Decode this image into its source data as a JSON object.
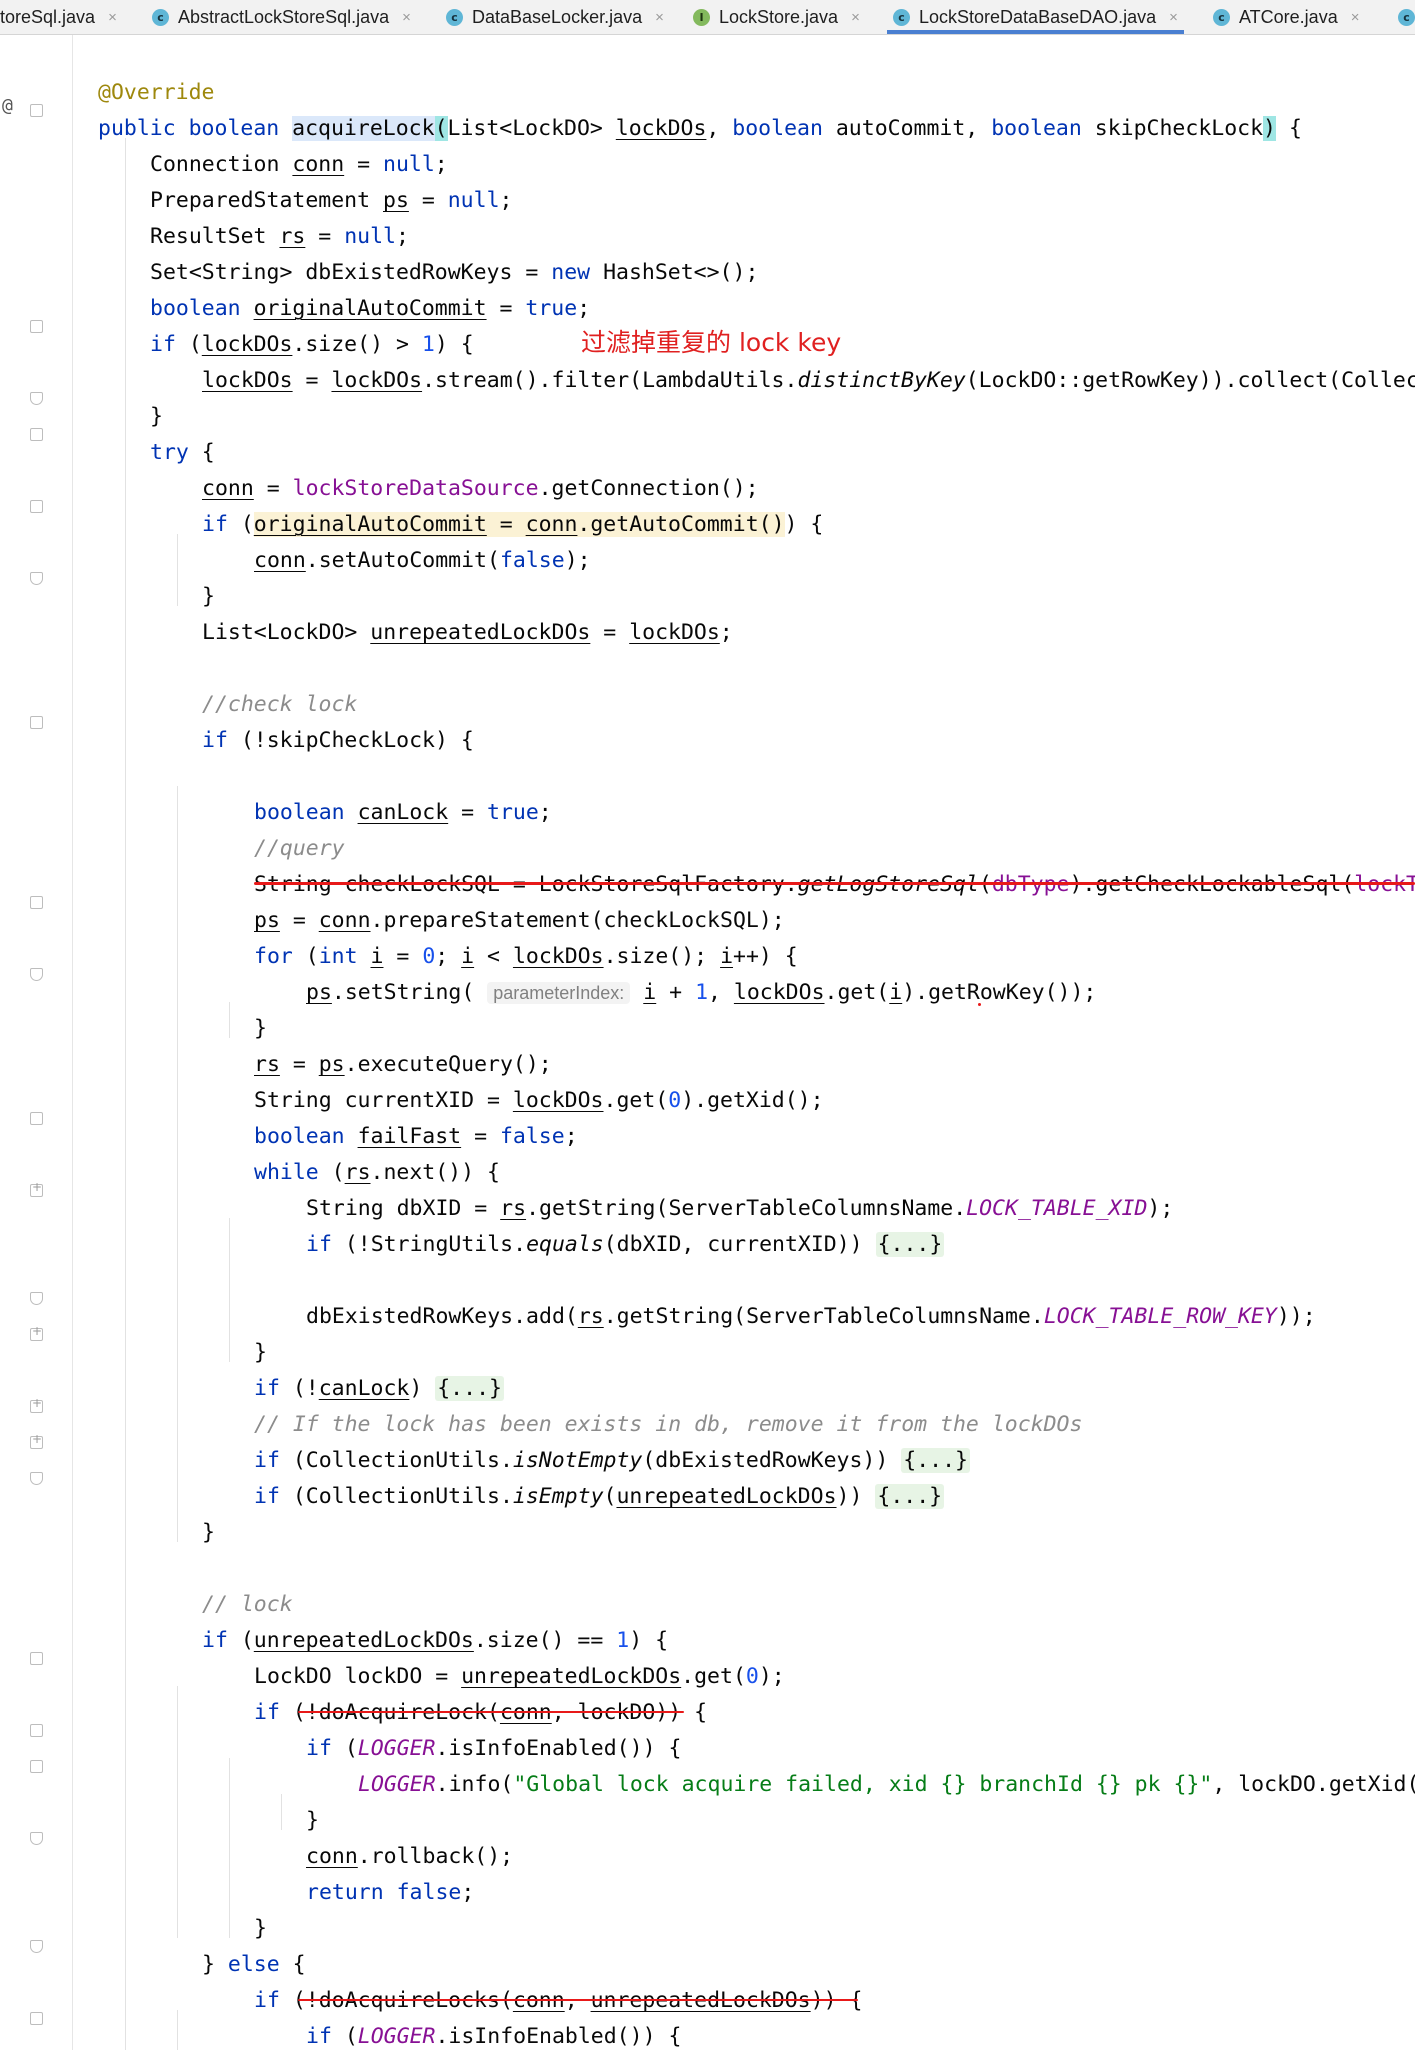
{
  "tabs": [
    {
      "label": "toreSql.java",
      "icon": "class-icon",
      "active": false
    },
    {
      "label": "AbstractLockStoreSql.java",
      "icon": "class-icon",
      "active": false
    },
    {
      "label": "DataBaseLocker.java",
      "icon": "class-icon",
      "active": false
    },
    {
      "label": "LockStore.java",
      "icon": "interface-icon",
      "active": false
    },
    {
      "label": "LockStoreDataBaseDAO.java",
      "icon": "class-icon",
      "active": true
    },
    {
      "label": "ATCore.java",
      "icon": "class-icon",
      "active": false
    }
  ],
  "tab_icon_glyphs": {
    "class": "c",
    "interface": "I",
    "close": "×"
  },
  "gutter": {
    "override_marker": "@"
  },
  "code": {
    "annotation": "@Override",
    "method_name": "acquireLock",
    "annotation_note": "过滤掉重复的 lock key",
    "param_hint": "parameterIndex:",
    "comment_check_lock": "//check lock",
    "comment_query": "//query",
    "comment_remove": "// If the lock has been exists in db, remove it from the lockDOs",
    "comment_lock": "// lock",
    "log_message": "\"Global lock acquire failed, xid {} branchId {} pk {}\"",
    "folded_body": "{...}"
  },
  "colors": {
    "keyword": "#0033b3",
    "number": "#1750eb",
    "string": "#067d17",
    "field": "#871094",
    "annotation": "#9e880d",
    "comment": "#8c8c8c",
    "red_markup": "#e81919",
    "active_tab_underline": "#4a7fd1"
  }
}
